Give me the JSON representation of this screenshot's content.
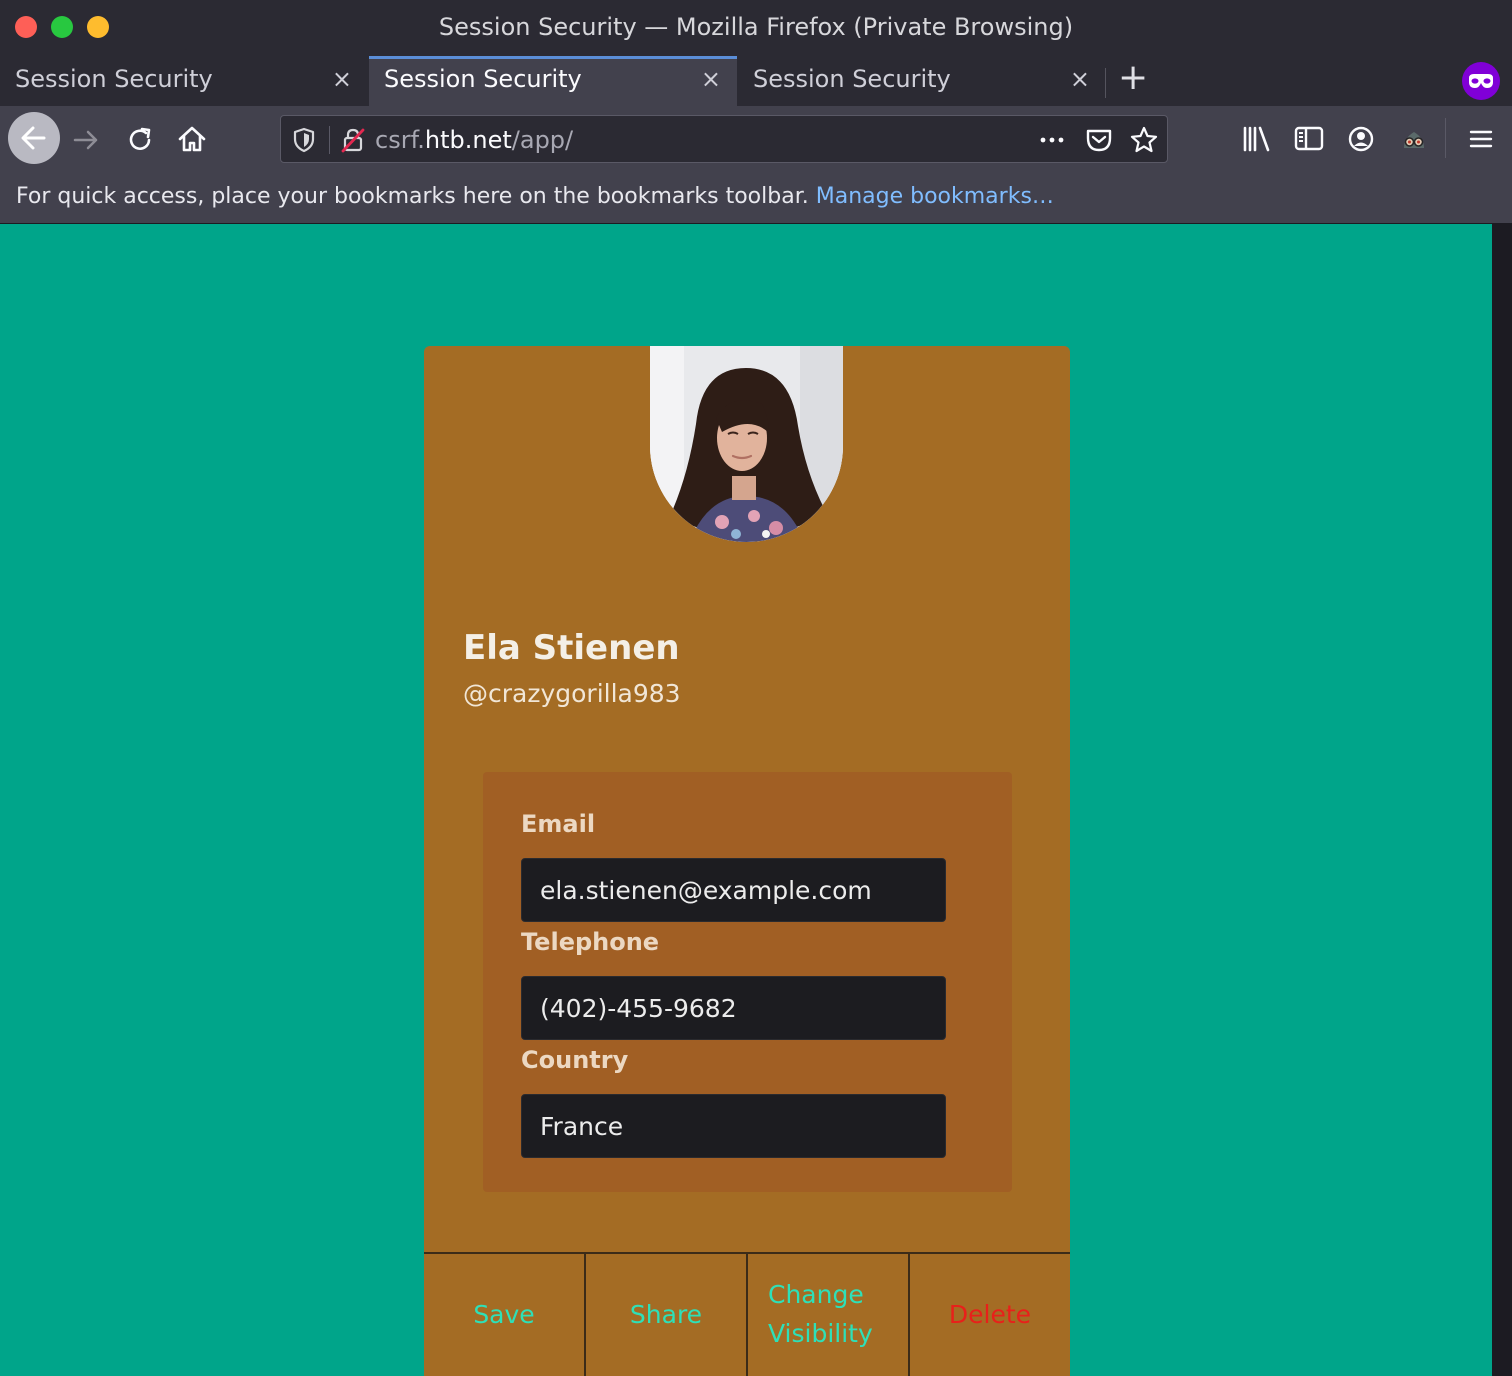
{
  "window": {
    "title": "Session Security — Mozilla Firefox (Private Browsing)"
  },
  "tabs": [
    {
      "label": "Session Security",
      "close": "×"
    },
    {
      "label": "Session Security",
      "close": "×",
      "active": true
    },
    {
      "label": "Session Security",
      "close": "×"
    }
  ],
  "tab_actions": {
    "new_tab": "+"
  },
  "navbar": {
    "url_scheme": "csrf.",
    "url_host": "htb.net",
    "url_path": "/app/",
    "icons": [
      "back-arrow-icon",
      "forward-arrow-icon",
      "reload-icon",
      "home-icon",
      "tracking-shield-icon",
      "insecure-lock-icon",
      "page-actions-icon",
      "pocket-icon",
      "bookmark-star-icon",
      "library-icon",
      "sidebar-icon",
      "account-icon",
      "extension-icon",
      "hamburger-menu-icon"
    ]
  },
  "bookmarks_bar": {
    "message": "For quick access, place your bookmarks here on the bookmarks toolbar.",
    "manage_link": "Manage bookmarks…"
  },
  "profile": {
    "name": "Ela Stienen",
    "handle": "@crazygorilla983",
    "fields": {
      "email_label": "Email",
      "email_value": "ela.stienen@example.com",
      "telephone_label": "Telephone",
      "telephone_value": "(402)-455-9682",
      "country_label": "Country",
      "country_value": "France"
    },
    "actions": {
      "save": "Save",
      "share": "Share",
      "change_visibility": "Change Visibility",
      "delete": "Delete"
    }
  },
  "colors": {
    "page_background": "#00a58a",
    "card_background": "#a46c24",
    "panel_background": "#a15f24",
    "action_link": "#2ee0b8",
    "delete_link": "#e8201a",
    "private_browsing_badge": "#8000d7"
  }
}
